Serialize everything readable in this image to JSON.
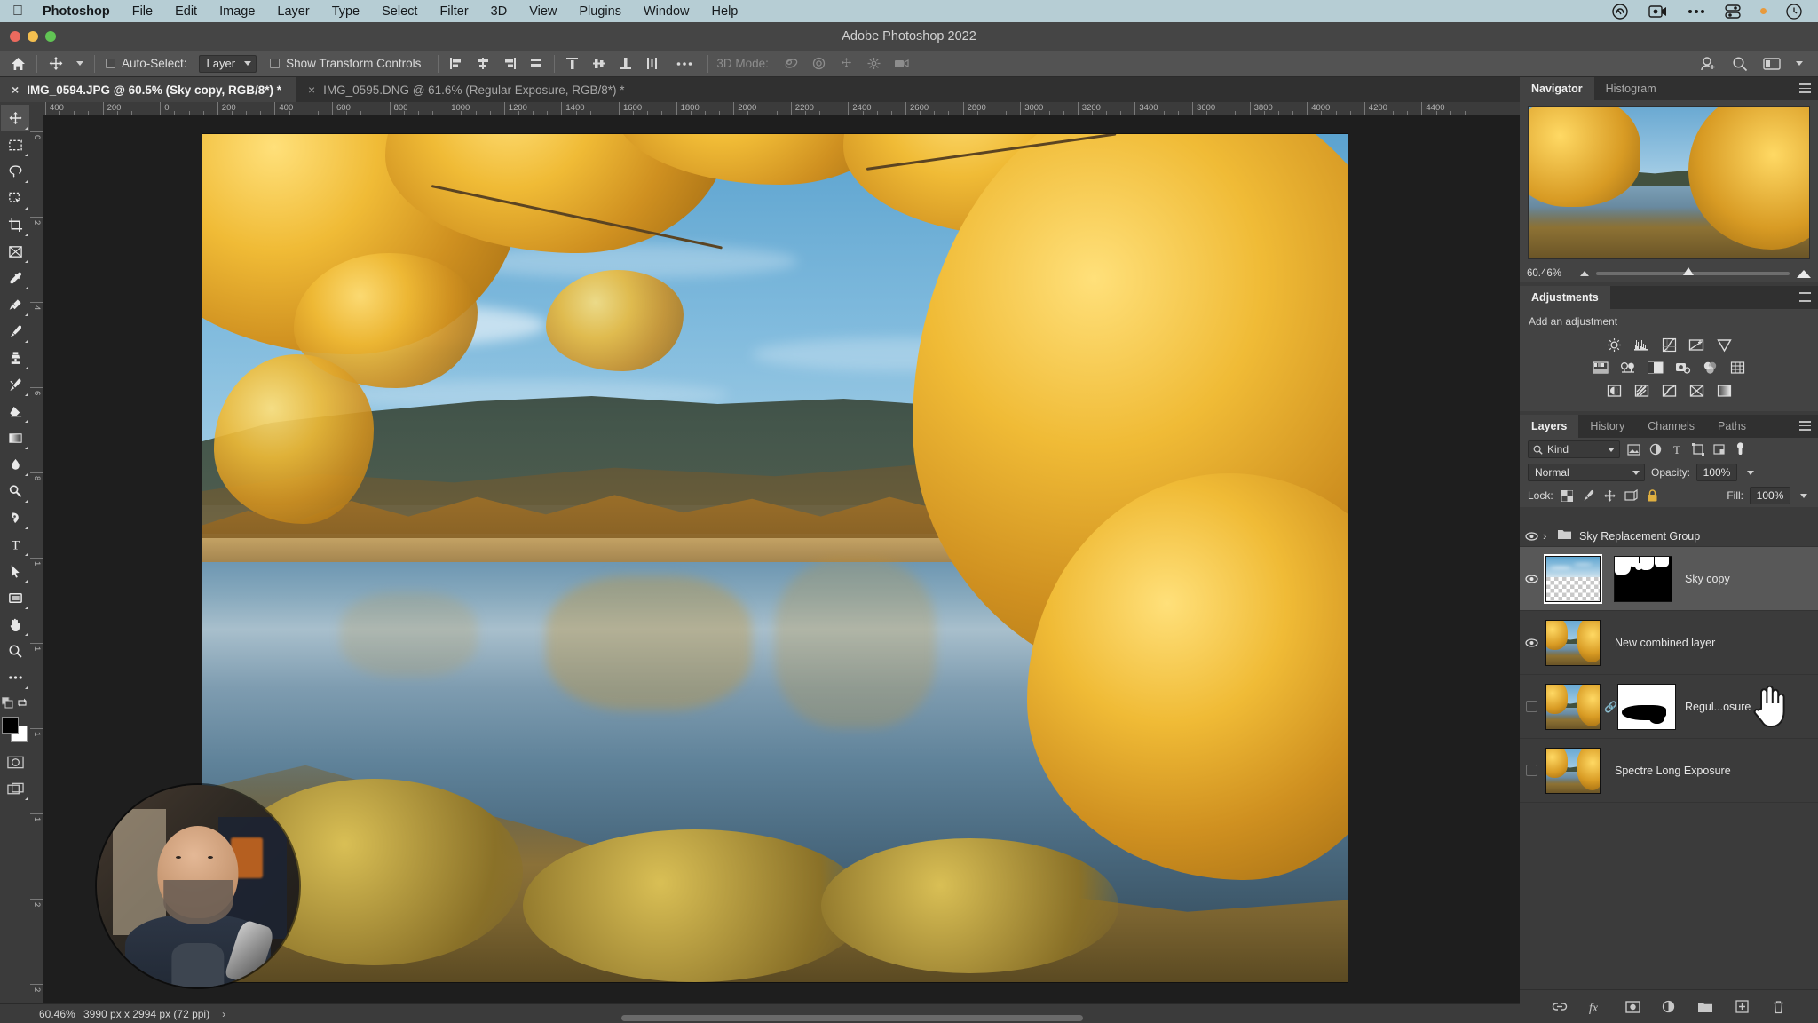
{
  "menubar": {
    "apple_icon": "apple-icon",
    "items": [
      {
        "label": "Photoshop",
        "bold": true
      },
      {
        "label": "File",
        "bold": false
      },
      {
        "label": "Edit",
        "bold": false
      },
      {
        "label": "Image",
        "bold": false
      },
      {
        "label": "Layer",
        "bold": false
      },
      {
        "label": "Type",
        "bold": false
      },
      {
        "label": "Select",
        "bold": false
      },
      {
        "label": "Filter",
        "bold": false
      },
      {
        "label": "3D",
        "bold": false
      },
      {
        "label": "View",
        "bold": false
      },
      {
        "label": "Plugins",
        "bold": false
      },
      {
        "label": "Window",
        "bold": false
      },
      {
        "label": "Help",
        "bold": false
      }
    ],
    "status_icons": [
      "creative-cloud-icon",
      "screen-record-icon",
      "ellipsis-icon",
      "control-center-icon",
      "orange-status-dot",
      "clock-icon"
    ]
  },
  "titlebar": {
    "title": "Adobe Photoshop 2022"
  },
  "options_bar": {
    "home_icon": "home-icon",
    "tool_icon": "move-tool-icon",
    "auto_select_label": "Auto-Select:",
    "auto_select_checked": false,
    "auto_select_value": "Layer",
    "show_transform_label": "Show Transform Controls",
    "show_transform_checked": false,
    "align_icons": [
      "align-left-edges-icon",
      "align-horizontal-centers-icon",
      "align-right-edges-icon",
      "align-top-edges-icon"
    ],
    "distribute_icons": [
      "distribute-top-icon",
      "distribute-vertical-centers-icon",
      "distribute-bottom-icon",
      "distribute-horizontal-icon"
    ],
    "more_icon": "ellipsis-icon",
    "mode_3d_label": "3D Mode:",
    "mode_3d_icons": [
      "3d-orbit-icon",
      "3d-roll-icon",
      "3d-pan-icon",
      "3d-slide-icon",
      "3d-camera-icon"
    ],
    "right_icons": [
      "share-user-icon",
      "search-icon",
      "workspace-icon",
      "chevron-down-icon"
    ]
  },
  "tabs": [
    {
      "label": "IMG_0594.JPG @ 60.5% (Sky copy, RGB/8*) *",
      "active": true,
      "close": "×"
    },
    {
      "label": "IMG_0595.DNG @ 61.6% (Regular Exposure, RGB/8*) *",
      "active": false,
      "close": "×"
    }
  ],
  "toolbar": {
    "tools": [
      {
        "name": "move-tool",
        "selected": true
      },
      {
        "name": "rectangular-marquee-tool",
        "selected": false
      },
      {
        "name": "lasso-tool",
        "selected": false
      },
      {
        "name": "object-selection-tool",
        "selected": false
      },
      {
        "name": "crop-tool",
        "selected": false
      },
      {
        "name": "frame-tool",
        "selected": false
      },
      {
        "name": "eyedropper-tool",
        "selected": false
      },
      {
        "name": "spot-healing-brush-tool",
        "selected": false
      },
      {
        "name": "brush-tool",
        "selected": false
      },
      {
        "name": "clone-stamp-tool",
        "selected": false
      },
      {
        "name": "history-brush-tool",
        "selected": false
      },
      {
        "name": "eraser-tool",
        "selected": false
      },
      {
        "name": "gradient-tool",
        "selected": false
      },
      {
        "name": "blur-tool",
        "selected": false
      },
      {
        "name": "dodge-tool",
        "selected": false
      },
      {
        "name": "pen-tool",
        "selected": false
      },
      {
        "name": "type-tool",
        "selected": false
      },
      {
        "name": "path-selection-tool",
        "selected": false
      },
      {
        "name": "rectangle-tool",
        "selected": false
      },
      {
        "name": "hand-tool",
        "selected": false
      },
      {
        "name": "zoom-tool",
        "selected": false
      },
      {
        "name": "edit-toolbar-tool",
        "selected": false
      }
    ],
    "foreground_color": "#000000",
    "background_color": "#ffffff",
    "quickmask_icon": "quick-mask-icon",
    "screenmode_icon": "screen-mode-icon"
  },
  "rulers": {
    "horizontal": [
      "400",
      "200",
      "0",
      "200",
      "400",
      "600",
      "800",
      "1000",
      "1200",
      "1400",
      "1600",
      "1800",
      "2000",
      "2200",
      "2400",
      "2600",
      "2800",
      "3000",
      "3200",
      "3400",
      "3600",
      "3800",
      "4000",
      "4200",
      "4400"
    ],
    "vertical": [
      "0",
      "2",
      "4",
      "6",
      "8",
      "1",
      "1",
      "1",
      "1",
      "2",
      "2"
    ]
  },
  "statusbar": {
    "zoom": "60.46%",
    "doc_info": "3990 px x 2994 px (72 ppi)",
    "arrow": "›"
  },
  "navigator": {
    "tabs": [
      {
        "label": "Navigator",
        "active": true
      },
      {
        "label": "Histogram",
        "active": false
      }
    ],
    "zoom_value": "60.46%",
    "menu_icon": "panel-menu-icon"
  },
  "adjustments": {
    "tabs": [
      {
        "label": "Adjustments",
        "active": true
      }
    ],
    "prompt": "Add an adjustment",
    "menu_icon": "panel-menu-icon",
    "row1": [
      "brightness-contrast-icon",
      "levels-icon",
      "curves-icon",
      "exposure-icon",
      "vibrance-icon"
    ],
    "row2": [
      "hue-saturation-icon",
      "color-balance-icon",
      "black-white-icon",
      "photo-filter-icon",
      "channel-mixer-icon",
      "color-lookup-icon"
    ],
    "row3": [
      "invert-icon",
      "posterize-icon",
      "threshold-icon",
      "selective-color-icon",
      "gradient-map-icon"
    ]
  },
  "layers_panel": {
    "tabs": [
      {
        "label": "Layers",
        "active": true
      },
      {
        "label": "History",
        "active": false
      },
      {
        "label": "Channels",
        "active": false
      },
      {
        "label": "Paths",
        "active": false
      }
    ],
    "menu_icon": "panel-menu-icon",
    "filter_label": "Kind",
    "filter_icons": [
      "filter-image-icon",
      "filter-adjustment-icon",
      "filter-type-icon",
      "filter-shape-icon",
      "filter-smartobject-icon",
      "filter-toggle-icon"
    ],
    "blend_mode": "Normal",
    "opacity_label": "Opacity:",
    "opacity_value": "100%",
    "lock_label": "Lock:",
    "lock_icons": [
      "lock-transparent-pixels-icon",
      "lock-image-pixels-icon",
      "lock-position-icon",
      "lock-artboard-icon",
      "lock-all-icon"
    ],
    "fill_label": "Fill:",
    "fill_value": "100%",
    "layers": [
      {
        "name": "Sky Replacement Group",
        "type": "group",
        "visible": true,
        "selected": false,
        "has_mask": false,
        "expand": "›",
        "folder_icon": "folder-icon"
      },
      {
        "name": "Sky copy",
        "type": "layer",
        "visible": true,
        "selected": true,
        "has_mask": true,
        "thumb": "sky-gradient",
        "mask": "sky-mask"
      },
      {
        "name": "New combined layer",
        "type": "layer",
        "visible": true,
        "selected": false,
        "has_mask": false,
        "thumb": "photo"
      },
      {
        "name": "Regul...osure",
        "type": "layer",
        "visible": false,
        "selected": false,
        "has_mask": true,
        "thumb": "photo",
        "mask": "river-mask",
        "link_icon": "link-icon"
      },
      {
        "name": "Spectre Long Exposure",
        "type": "layer",
        "visible": false,
        "selected": false,
        "has_mask": false,
        "thumb": "photo"
      }
    ],
    "footer_icons": [
      "link-layers-icon",
      "layer-style-fx-icon",
      "add-layer-mask-icon",
      "new-adjustment-layer-icon",
      "new-group-icon",
      "new-layer-icon",
      "delete-layer-icon"
    ]
  },
  "colors": {
    "menubar_bg": "#b6cdd4",
    "panel_bg": "#3b3b3b",
    "panel_header_bg": "#434343",
    "tab_active_bg": "#434343",
    "canvas_bg": "#1e1e1e",
    "selected_layer_bg": "#585858",
    "orange_dot": "#e89a3c"
  }
}
